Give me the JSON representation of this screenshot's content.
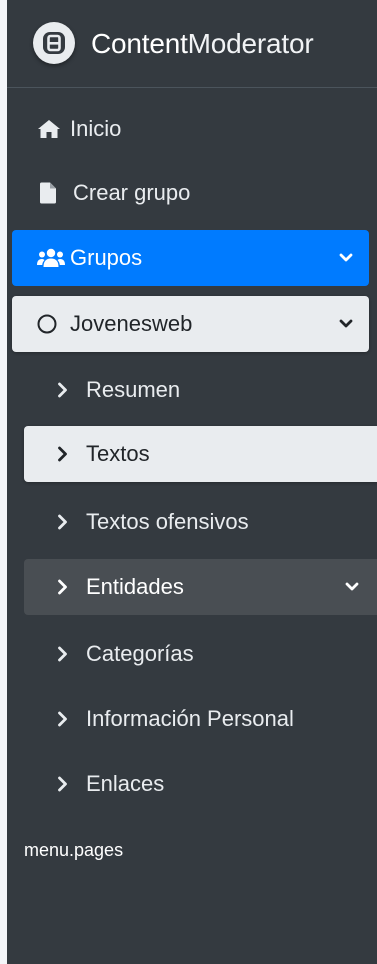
{
  "brand": {
    "name_strong": "Content",
    "name_light": "Moderator",
    "logo_icon": "brand-logo-icon"
  },
  "colors": {
    "sidebar_bg": "#343a40",
    "active_bg": "#007bff",
    "selected_bg": "#e9ecef",
    "hover_bg": "#494e53"
  },
  "menu": {
    "items": [
      {
        "label": "Inicio",
        "icon": "home-icon"
      },
      {
        "label": "Crear grupo",
        "icon": "file-icon"
      },
      {
        "label": "Grupos",
        "icon": "users-icon",
        "active": true,
        "expandable": true
      },
      {
        "label": "Jovenesweb",
        "icon": "circle-icon",
        "open": true,
        "expandable": true
      }
    ],
    "subitems": [
      {
        "label": "Resumen",
        "icon": "chevron-right-icon"
      },
      {
        "label": "Textos",
        "icon": "chevron-right-icon",
        "selected": true
      },
      {
        "label": "Textos ofensivos",
        "icon": "chevron-right-icon"
      },
      {
        "label": "Entidades",
        "icon": "chevron-right-icon",
        "expandable": true
      },
      {
        "label": "Categorías",
        "icon": "chevron-right-icon"
      },
      {
        "label": "Información Personal",
        "icon": "chevron-right-icon"
      },
      {
        "label": "Enlaces",
        "icon": "chevron-right-icon"
      }
    ],
    "pages_label": "menu.pages"
  }
}
